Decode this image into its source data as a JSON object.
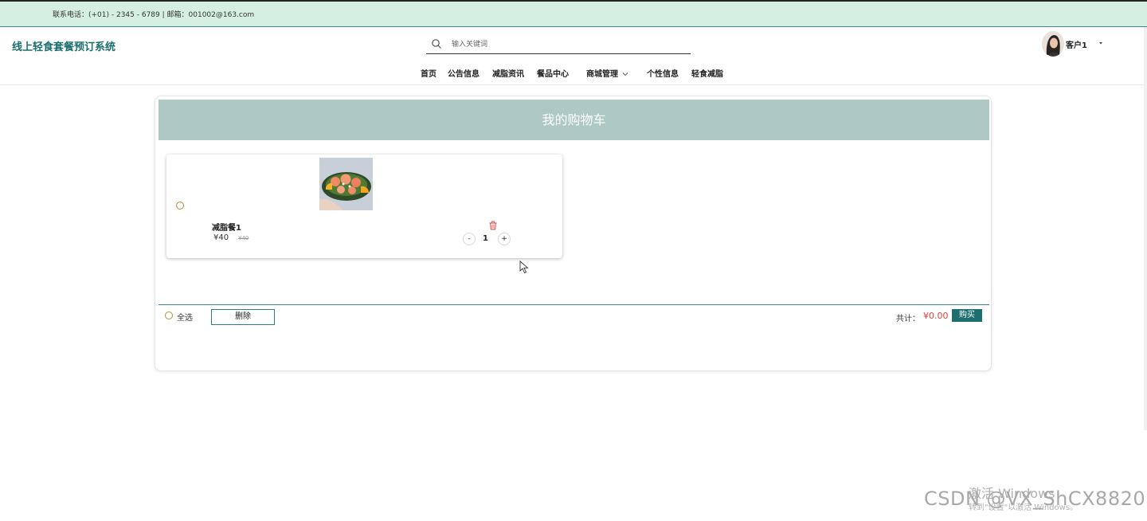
{
  "topbar": {
    "contact": "联系电话：(+01) - 2345 - 6789 | 邮箱：001002@163.com"
  },
  "header": {
    "brand": "线上轻食套餐预订系统",
    "search": {
      "placeholder": "输入关键词",
      "value": ""
    },
    "nav": [
      "首页",
      "公告信息",
      "减脂资讯",
      "餐品中心",
      "商城管理",
      "个性信息",
      "轻食减脂"
    ],
    "user": {
      "name": "客户1"
    }
  },
  "cart": {
    "title": "我的购物车",
    "items": [
      {
        "name": "减脂餐1",
        "price": "¥40",
        "original_price": "¥40",
        "quantity": "1",
        "selected": false
      }
    ],
    "footer": {
      "select_all": "全选",
      "delete": "删除",
      "total_label": "共计：",
      "total_value": "¥0.00",
      "buy": "购买"
    }
  },
  "stepper": {
    "minus": "-",
    "plus": "+"
  },
  "overlay": {
    "activate_title": "激活 Windows",
    "activate_sub": "转到\"设置\"以激活 Windows。",
    "csdn": "CSDN @VX_ShCX8820"
  },
  "colors": {
    "accent": "#1d6e6e",
    "banner": "#aec9c5",
    "topbar": "#d6efe3",
    "price": "#e0413a"
  },
  "icons": [
    "search-icon",
    "chevron-down-icon",
    "caret-down-icon",
    "trash-icon",
    "radio-icon"
  ]
}
